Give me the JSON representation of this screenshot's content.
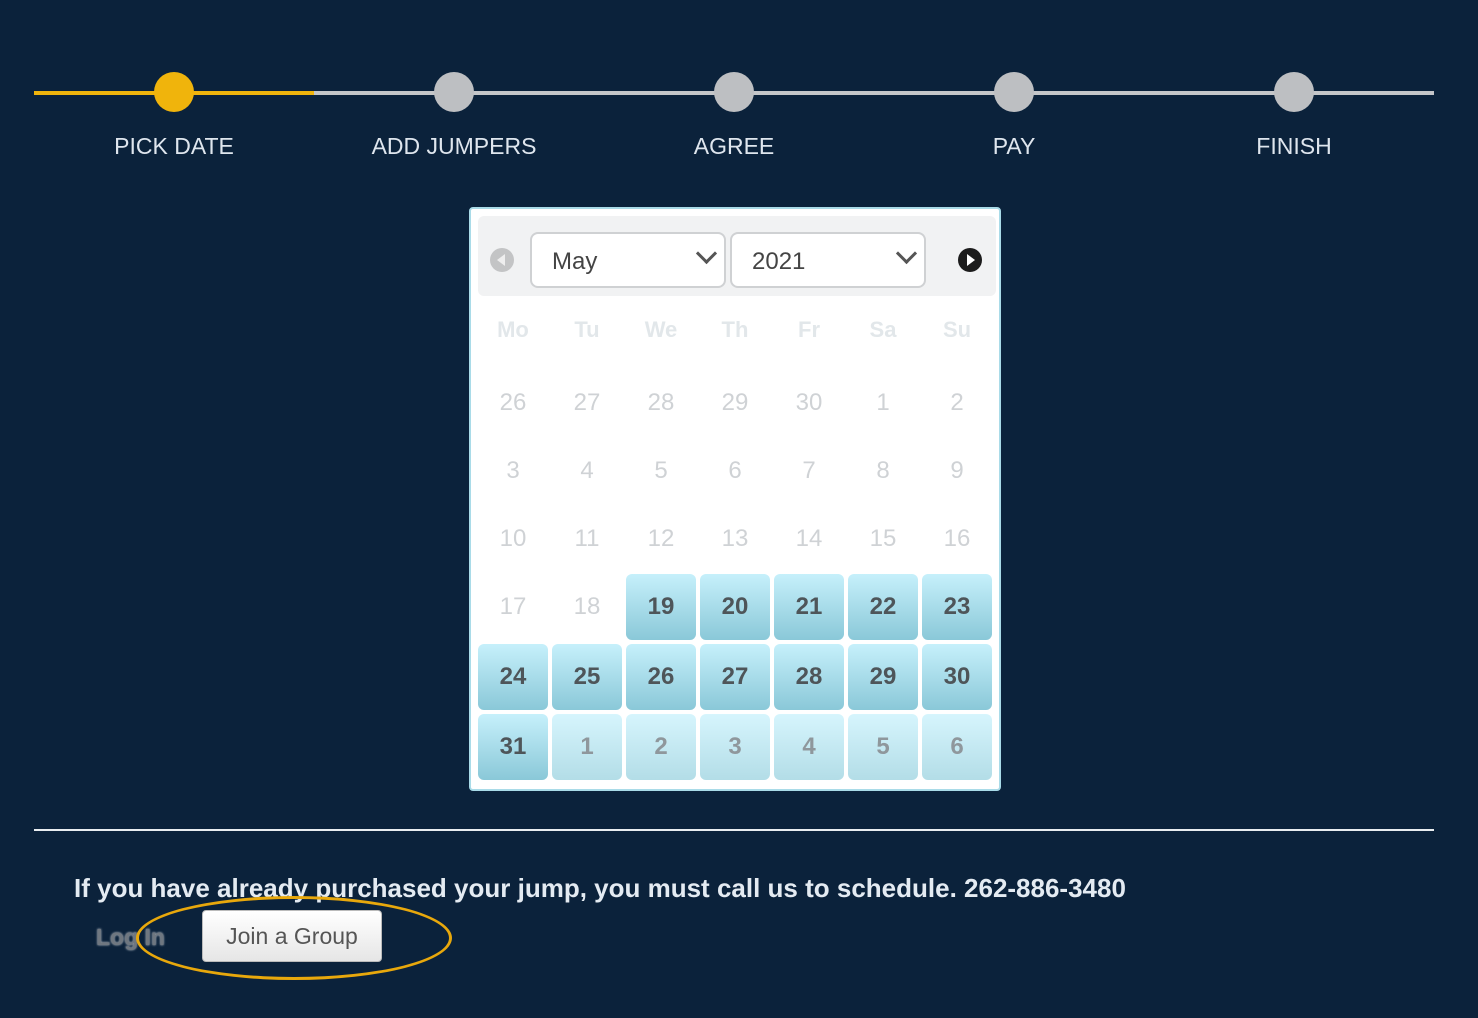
{
  "stepper": {
    "current_index": 0,
    "active_color": "#f0b40c",
    "steps": [
      {
        "label": "PICK DATE"
      },
      {
        "label": "ADD JUMPERS"
      },
      {
        "label": "AGREE"
      },
      {
        "label": "PAY"
      },
      {
        "label": "FINISH"
      }
    ]
  },
  "calendar": {
    "month": "May",
    "year": "2021",
    "prev_icon": "circle-chevron-left-icon",
    "next_icon": "circle-chevron-right-icon",
    "weekdays": [
      "Mo",
      "Tu",
      "We",
      "Th",
      "Fr",
      "Sa",
      "Su"
    ],
    "weeks": [
      [
        {
          "d": "26",
          "s": "disabled"
        },
        {
          "d": "27",
          "s": "disabled"
        },
        {
          "d": "28",
          "s": "disabled"
        },
        {
          "d": "29",
          "s": "disabled"
        },
        {
          "d": "30",
          "s": "disabled"
        },
        {
          "d": "1",
          "s": "disabled"
        },
        {
          "d": "2",
          "s": "disabled"
        }
      ],
      [
        {
          "d": "3",
          "s": "disabled"
        },
        {
          "d": "4",
          "s": "disabled"
        },
        {
          "d": "5",
          "s": "disabled"
        },
        {
          "d": "6",
          "s": "disabled"
        },
        {
          "d": "7",
          "s": "disabled"
        },
        {
          "d": "8",
          "s": "disabled"
        },
        {
          "d": "9",
          "s": "disabled"
        }
      ],
      [
        {
          "d": "10",
          "s": "disabled"
        },
        {
          "d": "11",
          "s": "disabled"
        },
        {
          "d": "12",
          "s": "disabled"
        },
        {
          "d": "13",
          "s": "disabled"
        },
        {
          "d": "14",
          "s": "disabled"
        },
        {
          "d": "15",
          "s": "disabled"
        },
        {
          "d": "16",
          "s": "disabled"
        }
      ],
      [
        {
          "d": "17",
          "s": "disabled"
        },
        {
          "d": "18",
          "s": "disabled"
        },
        {
          "d": "19",
          "s": "available"
        },
        {
          "d": "20",
          "s": "available"
        },
        {
          "d": "21",
          "s": "available"
        },
        {
          "d": "22",
          "s": "available"
        },
        {
          "d": "23",
          "s": "available"
        }
      ],
      [
        {
          "d": "24",
          "s": "available"
        },
        {
          "d": "25",
          "s": "available"
        },
        {
          "d": "26",
          "s": "available"
        },
        {
          "d": "27",
          "s": "available"
        },
        {
          "d": "28",
          "s": "available"
        },
        {
          "d": "29",
          "s": "available"
        },
        {
          "d": "30",
          "s": "available"
        }
      ],
      [
        {
          "d": "31",
          "s": "available"
        },
        {
          "d": "1",
          "s": "other"
        },
        {
          "d": "2",
          "s": "other"
        },
        {
          "d": "3",
          "s": "other"
        },
        {
          "d": "4",
          "s": "other"
        },
        {
          "d": "5",
          "s": "other"
        },
        {
          "d": "6",
          "s": "other"
        }
      ]
    ]
  },
  "footer": {
    "notice": "If you have already purchased your jump, you must call us to schedule. 262-886-3480",
    "login_label": "Log In",
    "join_group_label": "Join a Group",
    "highlight_color": "#e8a80c"
  }
}
